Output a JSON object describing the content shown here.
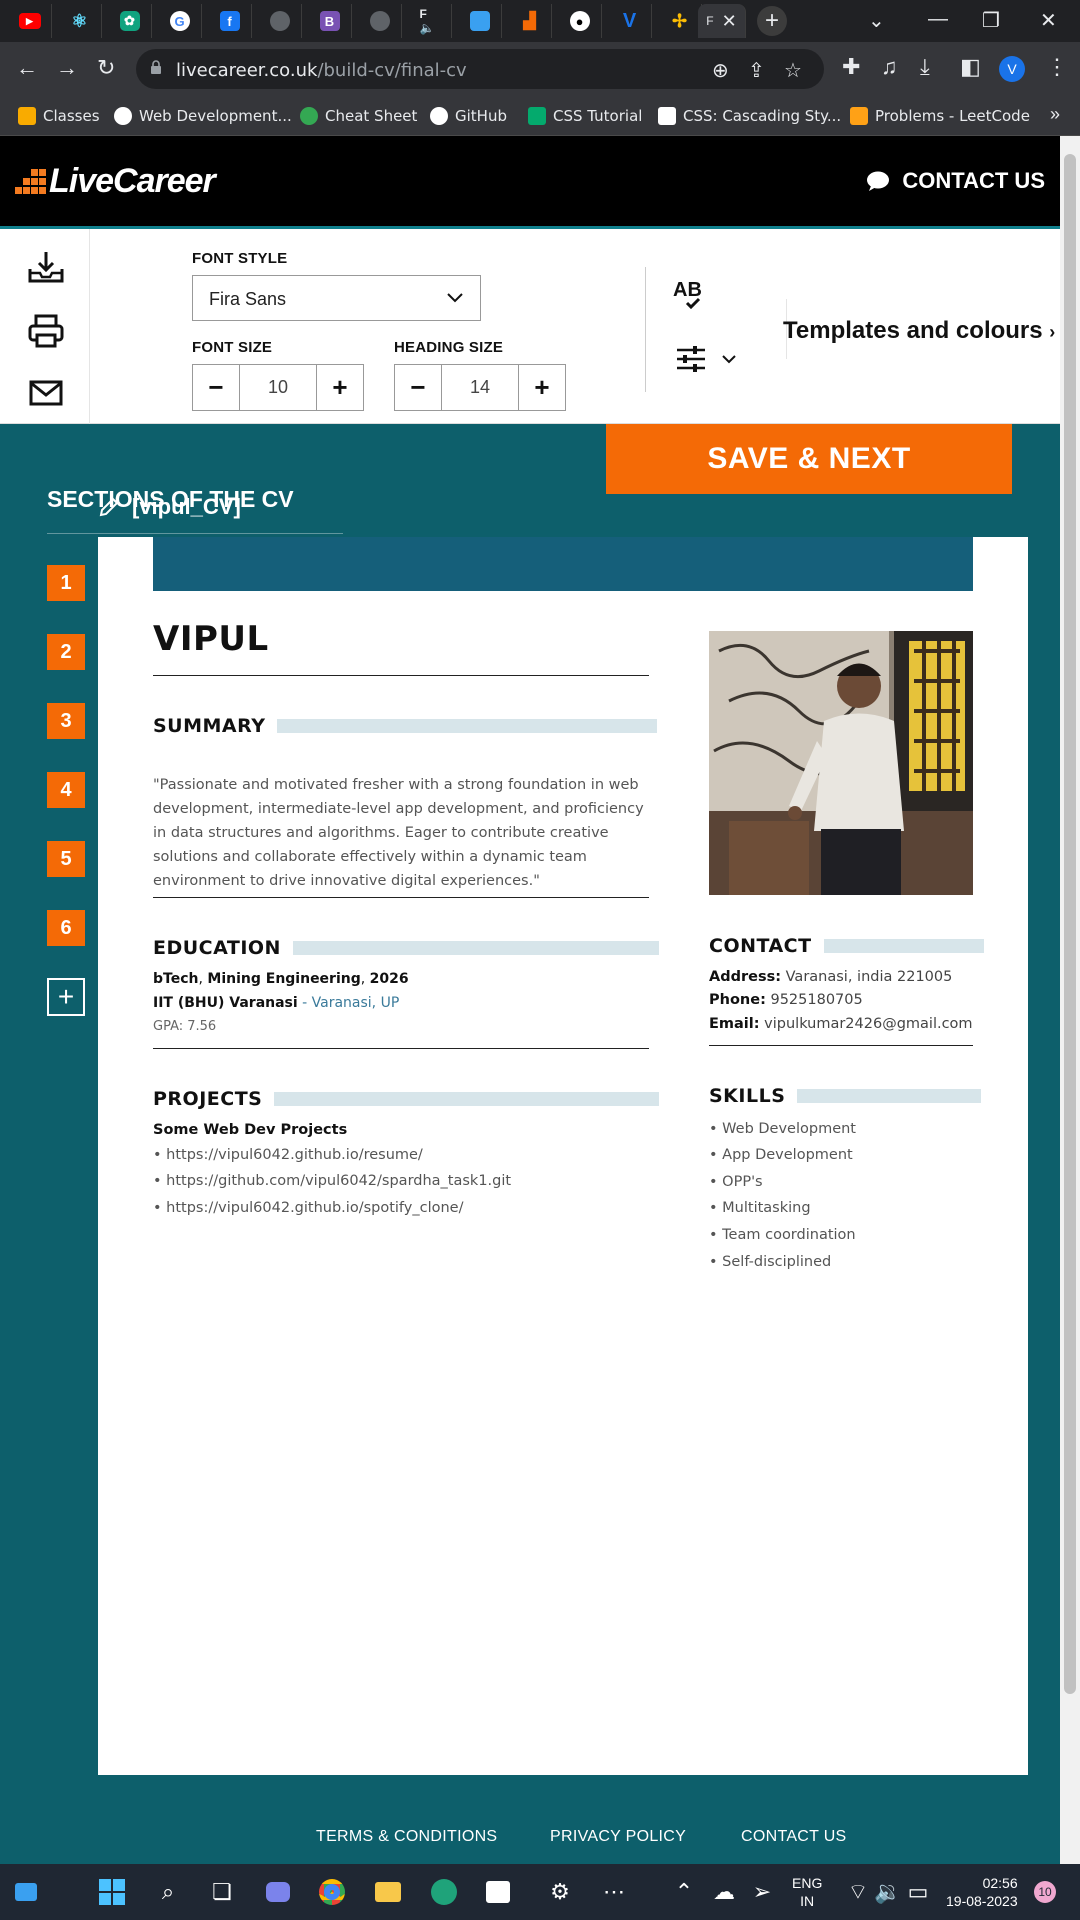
{
  "browser": {
    "tabs": [
      {
        "icon": "youtube-icon",
        "color": "#ff0000"
      },
      {
        "icon": "react-icon",
        "color": "#61dafb"
      },
      {
        "icon": "chatgpt-icon",
        "color": "#10a37f"
      },
      {
        "icon": "google-icon",
        "color": "#4285f4"
      },
      {
        "icon": "facebook-icon",
        "color": "#1877f2"
      },
      {
        "icon": "globe-icon",
        "color": "#9aa0a6"
      },
      {
        "icon": "bootstrap-icon",
        "color": "#7952b3"
      },
      {
        "icon": "globe-icon",
        "color": "#9aa0a6"
      },
      {
        "icon": "audio-tab-icon",
        "color": "#9aa0a6"
      },
      {
        "icon": "windows-app-icon",
        "color": "#3aa0f0"
      },
      {
        "icon": "bars-icon",
        "color": "#f46a06"
      },
      {
        "icon": "github-icon",
        "color": "#ffffff"
      },
      {
        "icon": "v-icon",
        "color": "#1a73e8"
      },
      {
        "icon": "pinwheel-icon",
        "color": "#fbbc04"
      }
    ],
    "active_tab_title": "F",
    "url_host": "livecareer.co.uk",
    "url_path": "/build-cv/final-cv",
    "profile_initial": "V",
    "bookmarks": [
      {
        "label": "Classes",
        "color": "#f9ab00"
      },
      {
        "label": "Web Development...",
        "color": "#ffffff"
      },
      {
        "label": "Cheat Sheet",
        "color": "#34a853"
      },
      {
        "label": "GitHub",
        "color": "#ffffff"
      },
      {
        "label": "CSS Tutorial",
        "color": "#04aa6d"
      },
      {
        "label": "CSS: Cascading Sty...",
        "color": "#ffffff"
      },
      {
        "label": "Problems - LeetCode",
        "color": "#ffa116"
      }
    ]
  },
  "site": {
    "logo": "LiveCareer",
    "contact_label": "CONTACT US"
  },
  "toolbar": {
    "font_style_label": "FONT STYLE",
    "font_style_value": "Fira Sans",
    "font_size_label": "FONT SIZE",
    "font_size_value": "10",
    "heading_size_label": "HEADING SIZE",
    "heading_size_value": "14",
    "spellcheck_label": "AB",
    "templates_label": "Templates and colours"
  },
  "main": {
    "save_button": "SAVE & NEXT",
    "sections_title": "SECTIONS OF THE CV",
    "cv_name": "[vipul_CV]",
    "section_numbers": [
      "1",
      "2",
      "3",
      "4",
      "5",
      "6"
    ]
  },
  "cv": {
    "name": "VIPUL",
    "summary_heading": "SUMMARY",
    "summary_text": "\"Passionate and motivated fresher with a strong foundation in web development, intermediate-level app development, and proficiency in data structures and algorithms. Eager to contribute creative solutions and collaborate effectively within a dynamic team environment to drive innovative digital experiences.\"",
    "education_heading": "EDUCATION",
    "education": {
      "degree": "bTech",
      "field": "Mining Engineering",
      "year": "2026",
      "institution": "IIT (BHU) Varanasi",
      "location": " - Varanasi, UP",
      "gpa": "GPA: 7.56"
    },
    "projects_heading": "PROJECTS",
    "projects_subtitle": "Some Web Dev Projects",
    "projects": [
      "• https://vipul6042.github.io/resume/",
      "• https://github.com/vipul6042/spardha_task1.git",
      "• https://vipul6042.github.io/spotify_clone/"
    ],
    "contact_heading": "CONTACT",
    "contact": {
      "address_label": "Address:",
      "address": " Varanasi, india 221005",
      "phone_label": "Phone:",
      "phone": " 9525180705",
      "email_label": "Email:",
      "email": " vipulkumar2426@gmail.com"
    },
    "skills_heading": "SKILLS",
    "skills": [
      "• Web Development",
      "• App Development",
      "• OPP's",
      "• Multitasking",
      "• Team coordination",
      "• Self-disciplined"
    ]
  },
  "footer": {
    "terms": "TERMS & CONDITIONS",
    "privacy": "PRIVACY POLICY",
    "contact": "CONTACT US"
  },
  "taskbar": {
    "language": "ENG",
    "region": "IN",
    "time": "02:56",
    "date": "19-08-2023",
    "notification_count": "10"
  }
}
